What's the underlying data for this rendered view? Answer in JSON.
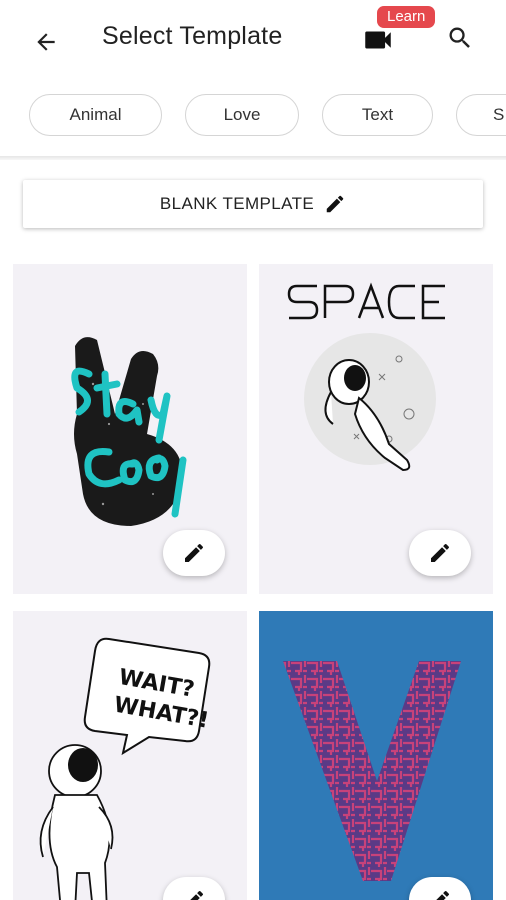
{
  "app_bar": {
    "title": "Select Template",
    "back_icon": "arrow-left-icon",
    "video_icon": "videocam-icon",
    "learn_badge": "Learn",
    "search_icon": "search-icon"
  },
  "categories": [
    "Animal",
    "Love",
    "Text",
    "S"
  ],
  "blank_template": {
    "label": "BLANK TEMPLATE",
    "icon": "pencil-icon"
  },
  "templates": [
    {
      "name": "stay-cool-peace-hand",
      "lettering": "Stay Cool"
    },
    {
      "name": "space-astronaut",
      "lettering": "SPACE"
    },
    {
      "name": "wait-what-astronaut",
      "lettering": "WAIT? WHAT?!"
    },
    {
      "name": "maze-letter-v",
      "lettering": "V"
    }
  ],
  "colors": {
    "accent_badge": "#e5484d",
    "card_bg": "#f3f1f6",
    "blue_card_bg": "#2f7ab7",
    "teal_text": "#1fc3c3",
    "maze_color": "#b03a73"
  }
}
